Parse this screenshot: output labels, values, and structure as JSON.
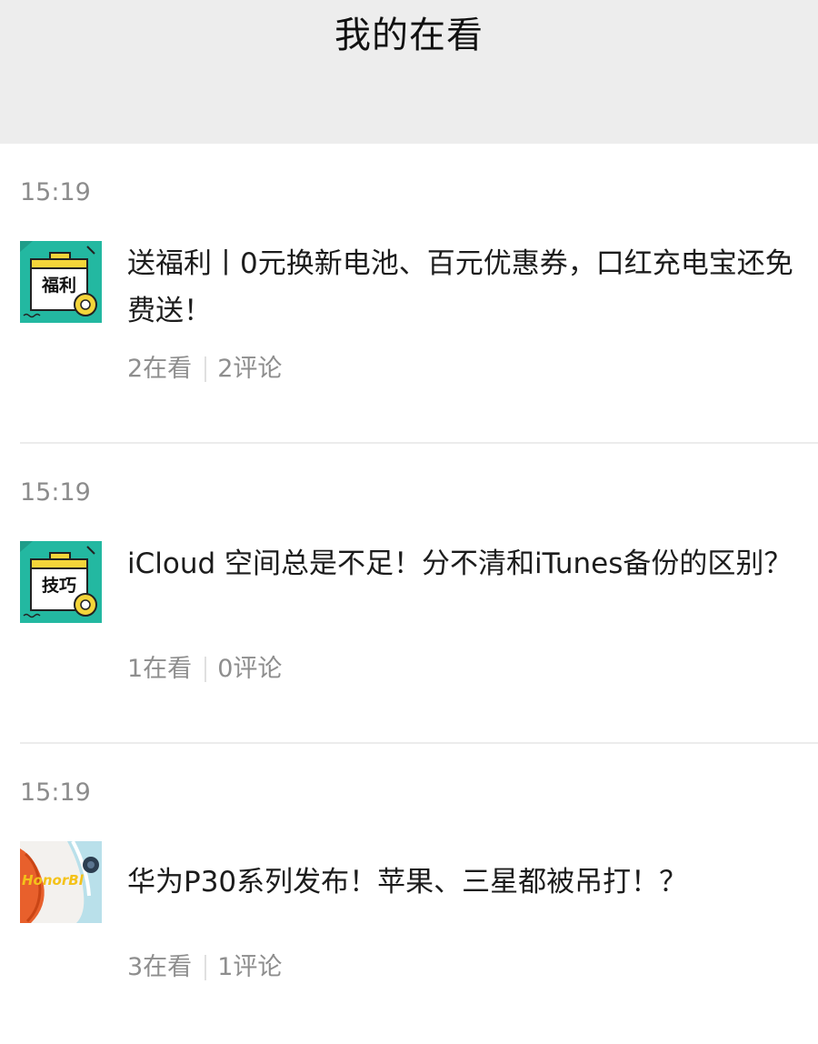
{
  "header": {
    "title": "我的在看"
  },
  "entries": [
    {
      "time": "15:19",
      "thumb_label": "福利",
      "title": "送福利丨0元换新电池、百元优惠券，口红充电宝还免费送！",
      "views": "2在看",
      "comments": "2评论"
    },
    {
      "time": "15:19",
      "thumb_label": "技巧",
      "title": "iCloud 空间总是不足！分不清和iTunes备份的区别？",
      "views": "1在看",
      "comments": "0评论"
    },
    {
      "time": "15:19",
      "thumb_label": "HonorBl",
      "title": "华为P30系列发布！苹果、三星都被吊打！？",
      "views": "3在看",
      "comments": "1评论"
    }
  ],
  "colors": {
    "header_bg": "#ededed",
    "thumb_teal": "#23b8a1",
    "thumb_yellow": "#f4d53a"
  }
}
